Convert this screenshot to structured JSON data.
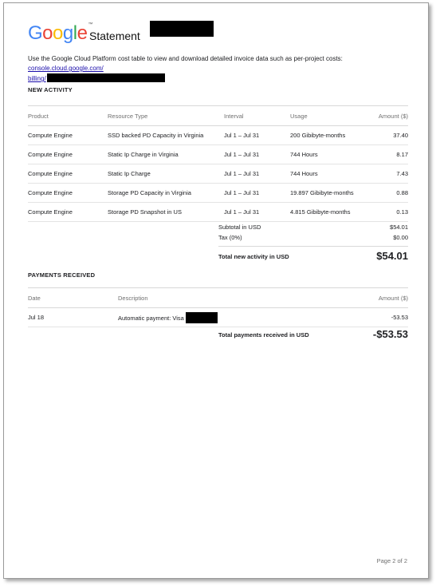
{
  "header": {
    "logo_text": "Google",
    "logo_tm": "™",
    "logo_colors": [
      "#4285F4",
      "#EA4335",
      "#FBBC05",
      "#4285F4",
      "#34A853",
      "#EA4335"
    ],
    "title": "Statement"
  },
  "intro": {
    "text": "Use the Google Cloud Platform cost table to view and download detailed invoice data such as per-project costs: ",
    "link_part1": "console.cloud.google.com/",
    "link_part2": "billing/"
  },
  "new_activity": {
    "title": "NEW ACTIVITY",
    "columns": [
      "Product",
      "Resource Type",
      "Interval",
      "Usage",
      "Amount ($)"
    ],
    "rows": [
      [
        "Compute Engine",
        "SSD backed PD Capacity in Virginia",
        "Jul 1 – Jul 31",
        "200 Gibibyte-months",
        "37.40"
      ],
      [
        "Compute Engine",
        "Static Ip Charge in Virginia",
        "Jul 1 – Jul 31",
        "744 Hours",
        "8.17"
      ],
      [
        "Compute Engine",
        "Static Ip Charge",
        "Jul 1 – Jul 31",
        "744 Hours",
        "7.43"
      ],
      [
        "Compute Engine",
        "Storage PD Capacity in Virginia",
        "Jul 1 – Jul 31",
        "19.897 Gibibyte-months",
        "0.88"
      ],
      [
        "Compute Engine",
        "Storage PD Snapshot in US",
        "Jul 1 – Jul 31",
        "4.815 Gibibyte-months",
        "0.13"
      ]
    ],
    "subtotal_label": "Subtotal in USD",
    "subtotal_value": "$54.01",
    "tax_label": "Tax (0%)",
    "tax_value": "$0.00",
    "total_label": "Total new activity in USD",
    "total_value": "$54.01"
  },
  "payments": {
    "title": "PAYMENTS RECEIVED",
    "columns": [
      "Date",
      "Description",
      "Amount ($)"
    ],
    "rows": [
      [
        "Jul 18",
        "Automatic payment: Visa",
        "-53.53"
      ]
    ],
    "total_label": "Total payments received in USD",
    "total_value": "-$53.53"
  },
  "footer": {
    "page": "Page 2 of 2"
  }
}
